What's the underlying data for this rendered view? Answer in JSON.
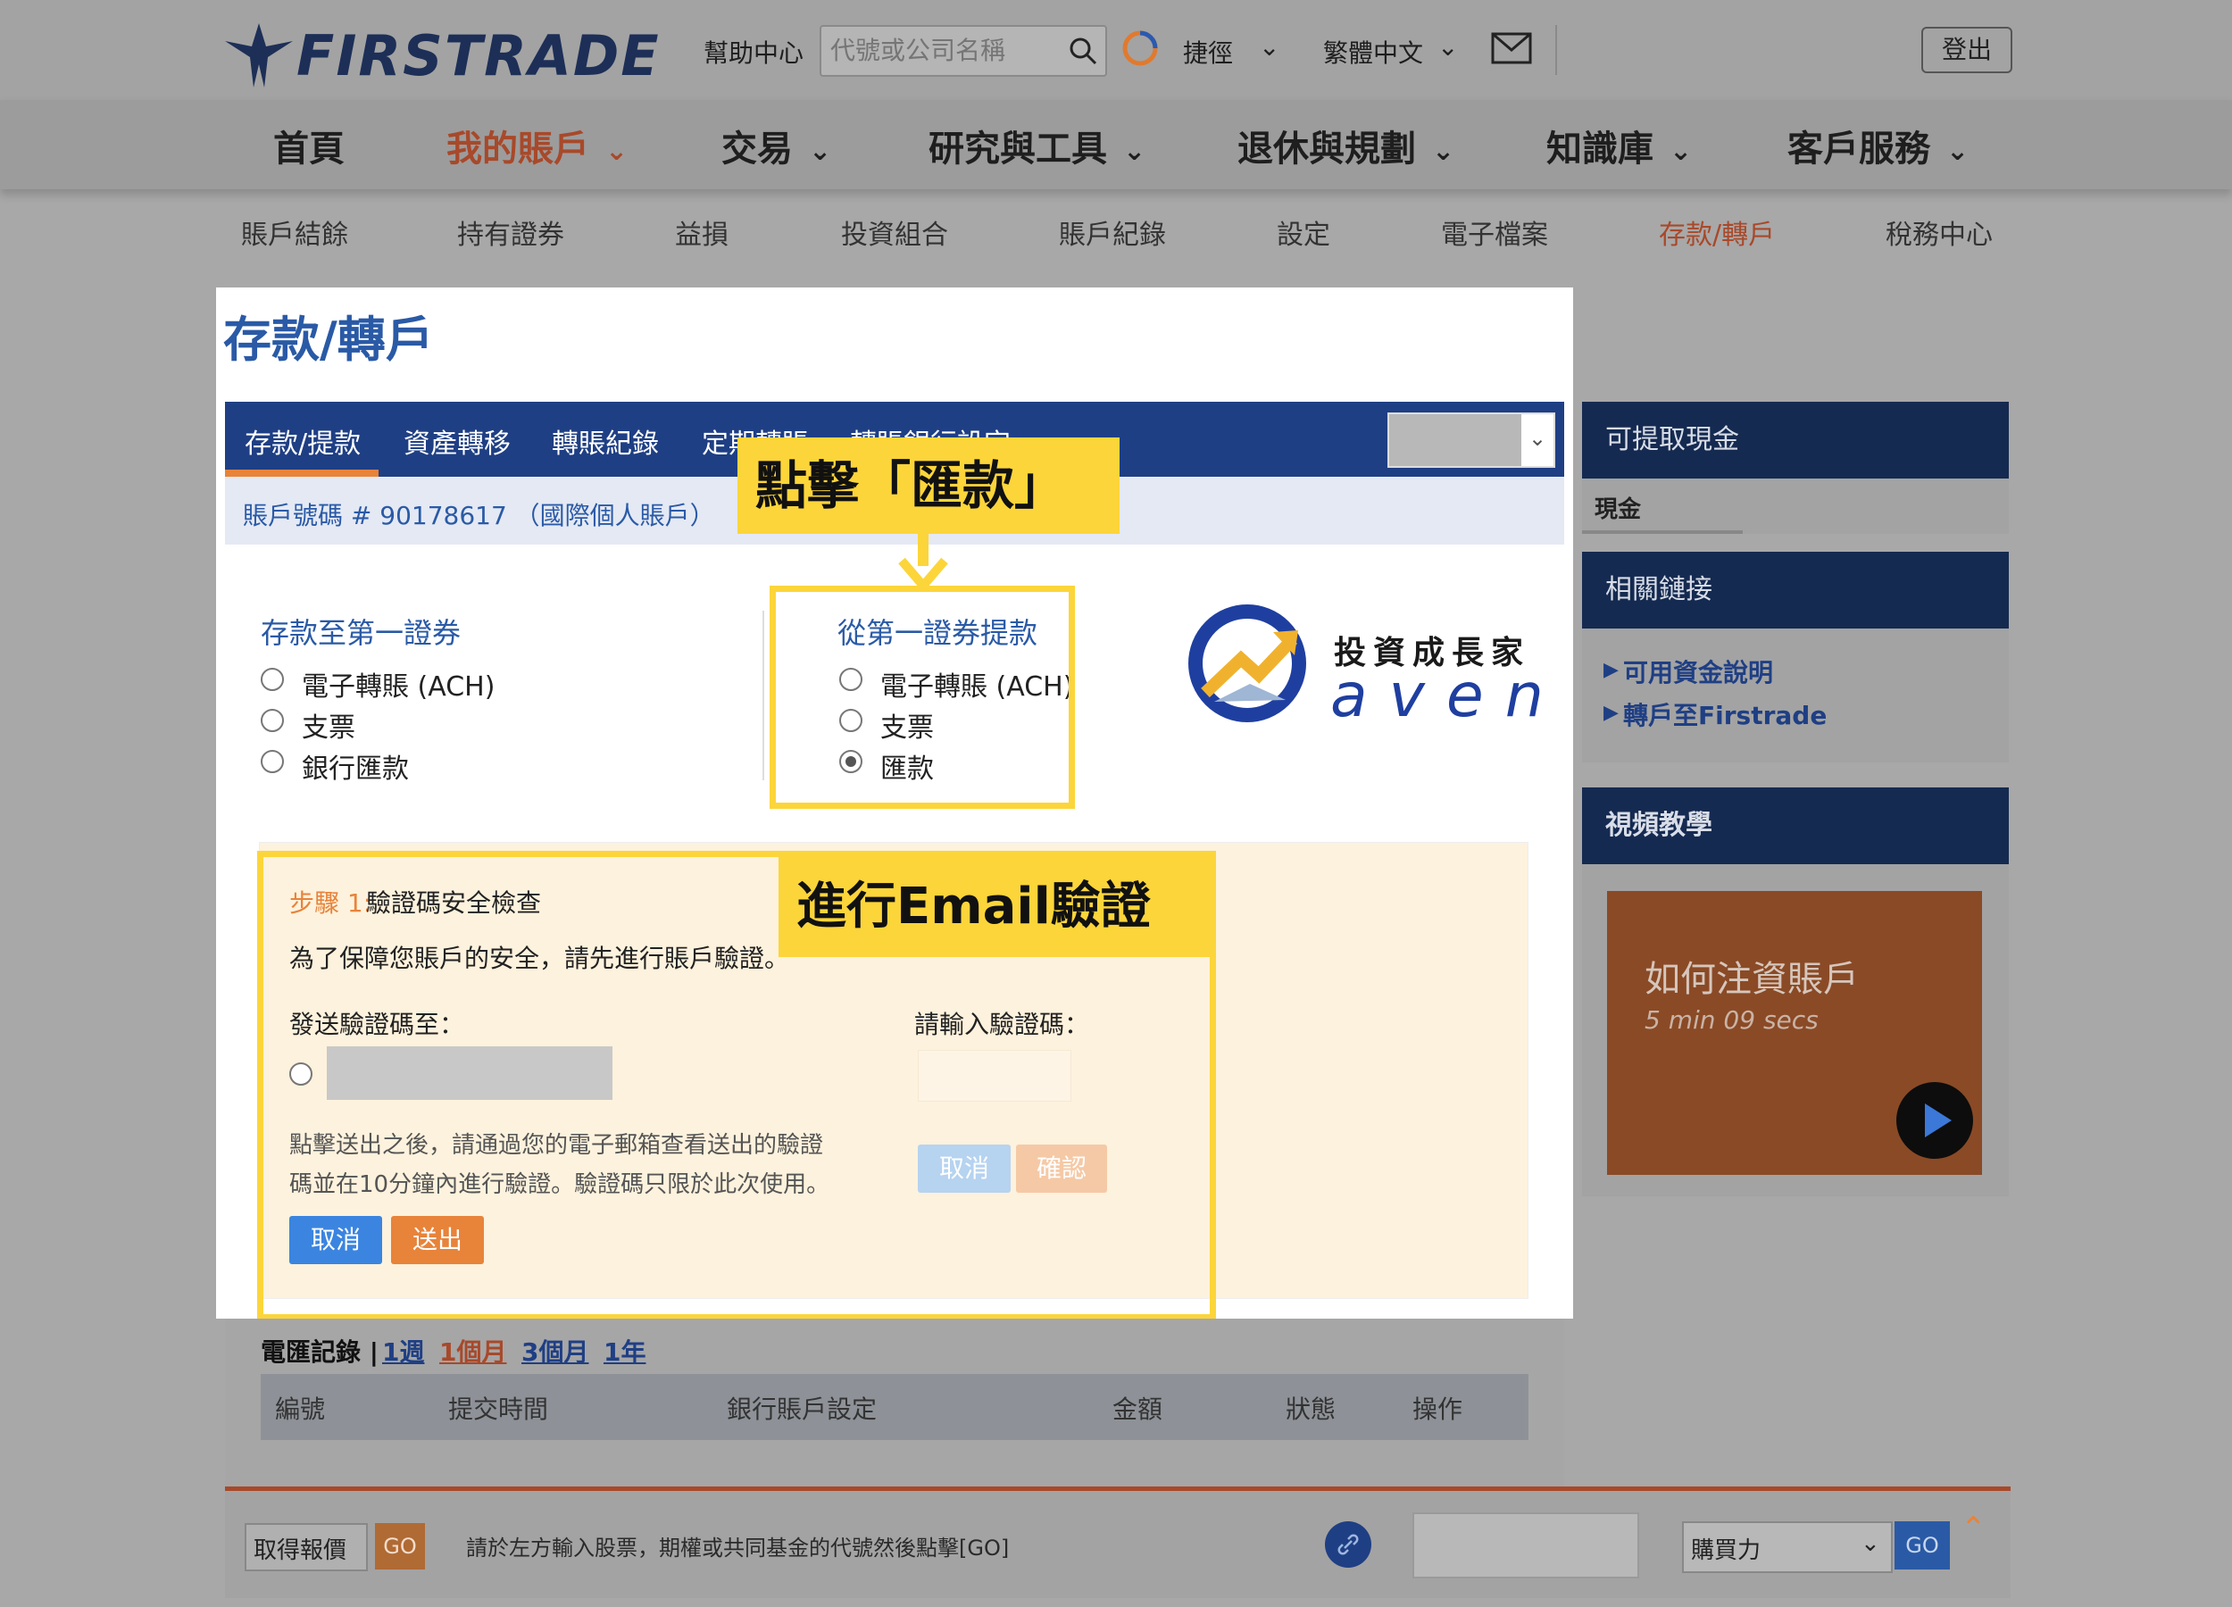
{
  "header": {
    "logo_text": "FIRSTRADE",
    "help": "幫助中心",
    "search_placeholder": "代號或公司名稱",
    "shortcut": "捷徑",
    "language": "繁體中文",
    "logout": "登出"
  },
  "main_nav": [
    "首頁",
    "我的賬戶",
    "交易",
    "研究與工具",
    "退休與規劃",
    "知識庫",
    "客戶服務"
  ],
  "sub_nav": [
    "賬戶結餘",
    "持有證券",
    "益損",
    "投資組合",
    "賬戶紀錄",
    "設定",
    "電子檔案",
    "存款/轉戶",
    "稅務中心"
  ],
  "page_title": "存款/轉戶",
  "tabs": [
    "存款/提款",
    "資產轉移",
    "轉賬紀錄",
    "定期轉賬",
    "轉賬銀行設定"
  ],
  "account_label": "賬戶號碼 # 90178617 （國際個人賬戶）",
  "deposit": {
    "title": "存款至第一證券",
    "options": [
      "電子轉賬 (ACH)",
      "支票",
      "銀行匯款"
    ]
  },
  "withdraw": {
    "title": "從第一證券提款",
    "options": [
      "電子轉賬 (ACH)",
      "支票",
      "匯款"
    ],
    "selected": "匯款"
  },
  "brand": {
    "cn": "投資成長家",
    "en": "aven"
  },
  "callouts": {
    "click_wire": "點擊「匯款」",
    "email_verify": "進行Email驗證"
  },
  "step": {
    "label": "步驟 1:",
    "title": "驗證碼安全檢查",
    "desc": "為了保障您賬戶的安全，請先進行賬戶驗證。",
    "send_to": "發送驗證碼至：",
    "enter_code": "請輸入驗證碼：",
    "note1": "點擊送出之後，請通過您的電子郵箱查看送出的驗證",
    "note2": "碼並在10分鐘內進行驗證。驗證碼只限於此次使用。",
    "cancel": "取消",
    "submit": "送出",
    "cancel2": "取消",
    "confirm": "確認"
  },
  "sidebar": {
    "cash_title": "可提取現金",
    "cash_label": "現金",
    "links_title": "相關鏈接",
    "links": [
      "可用資金說明",
      "轉戶至Firstrade"
    ],
    "video_title": "視頻教學",
    "video_name": "如何注資賬戶",
    "video_len": "5 min 09 secs"
  },
  "records": {
    "title": "電匯記錄 |",
    "periods": [
      "1週",
      "1個月",
      "3個月",
      "1年"
    ],
    "columns": [
      "編號",
      "提交時間",
      "銀行賬戶設定",
      "金額",
      "狀態",
      "操作"
    ]
  },
  "bottom": {
    "quote": "取得報價",
    "go": "GO",
    "hint": "請於左方輸入股票，期權或共同基金的代號然後點擊[GO]",
    "buying_power": "購買力",
    "go2": "GO"
  },
  "colors": {
    "navy": "#1f3f84",
    "orange": "#e8833a",
    "yellow": "#fcd53a",
    "active_nav": "#a8492a"
  }
}
